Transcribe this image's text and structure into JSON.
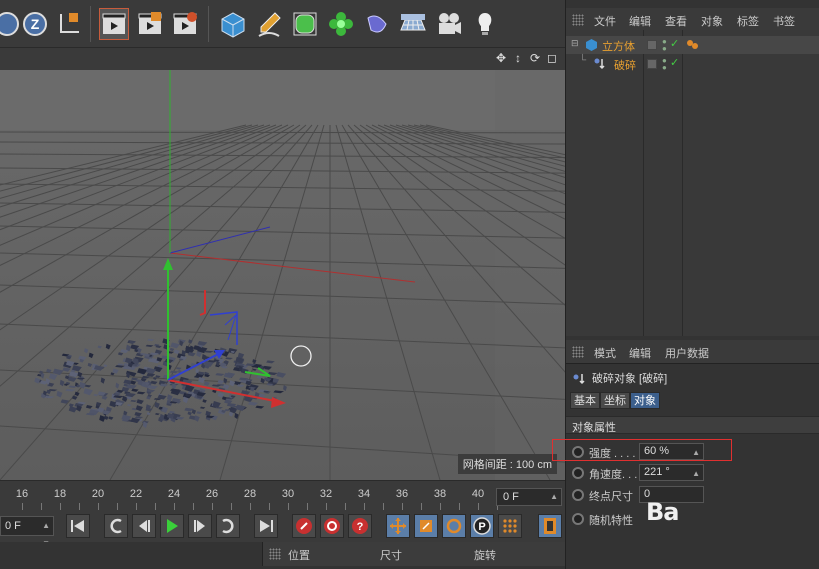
{
  "toolbar": {
    "icons": [
      "x-axis-lock-icon",
      "z-axis-lock-icon",
      "coordinate-system-icon",
      "render-active-view-icon",
      "render-picture-viewer-icon",
      "render-settings-icon",
      "cube-icon",
      "pen-icon",
      "subdivision-icon",
      "cloner-icon",
      "deformer-icon",
      "floor-icon",
      "camera-icon",
      "light-icon"
    ],
    "z_label": "Z"
  },
  "viewport": {
    "grid_spacing_label": "网格间距 : 100 cm"
  },
  "timeline": {
    "ticks": [
      "16",
      "18",
      "20",
      "22",
      "24",
      "26",
      "28",
      "30",
      "32",
      "34",
      "36",
      "38",
      "40"
    ],
    "end_frame": "0 F",
    "start_frame": "0 F"
  },
  "coords": {
    "position": "位置",
    "size": "尺寸",
    "rotation": "旋转"
  },
  "object_manager": {
    "menu": [
      "文件",
      "编辑",
      "查看",
      "对象",
      "标签",
      "书签"
    ],
    "objects": [
      {
        "name": "立方体"
      },
      {
        "name": "破碎"
      }
    ]
  },
  "attributes": {
    "menu": [
      "模式",
      "编辑",
      "用户数据"
    ],
    "title": "破碎对象 [破碎]",
    "tabs": [
      "基本",
      "坐标",
      "对象"
    ],
    "active_tab": "对象",
    "section": "对象属性",
    "props": [
      {
        "label": "强度 . . . .",
        "value": "60 %"
      },
      {
        "label": "角速度. . .",
        "value": "221 °"
      },
      {
        "label": "终点尺寸",
        "value": "0"
      },
      {
        "label": "随机特性",
        "value": ""
      }
    ],
    "watermark": "Ba"
  },
  "colors": {
    "accent": "#3c5f8c",
    "object_name": "#e8a030",
    "highlight": "#e03030"
  }
}
